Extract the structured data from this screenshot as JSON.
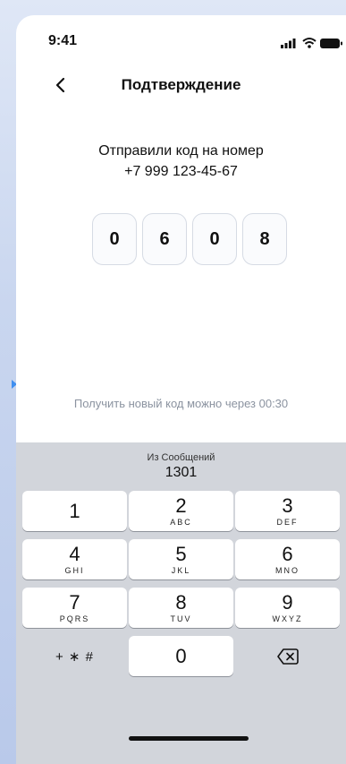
{
  "status_bar": {
    "time": "9:41",
    "icons": [
      "signal-icon",
      "wifi-icon",
      "battery-icon"
    ]
  },
  "header": {
    "title": "Подтверждение",
    "back_icon": "chevron-left-icon"
  },
  "content": {
    "sent_label": "Отправили код на номер",
    "phone_number": "+7 999 123-45-67",
    "code_digits": [
      "0",
      "6",
      "0",
      "8"
    ],
    "resend_text": "Получить новый код можно через 00:30"
  },
  "keyboard": {
    "suggestion_label": "Из Сообщений",
    "suggestion_code": "1301",
    "keys": [
      {
        "num": "1",
        "letters": ""
      },
      {
        "num": "2",
        "letters": "ABC"
      },
      {
        "num": "3",
        "letters": "DEF"
      },
      {
        "num": "4",
        "letters": "GHI"
      },
      {
        "num": "5",
        "letters": "JKL"
      },
      {
        "num": "6",
        "letters": "MNO"
      },
      {
        "num": "7",
        "letters": "PQRS"
      },
      {
        "num": "8",
        "letters": "TUV"
      },
      {
        "num": "9",
        "letters": "WXYZ"
      }
    ],
    "symbols_label": "+ ∗ #",
    "zero_label": "0",
    "delete_icon": "backspace-icon"
  },
  "colors": {
    "accent": "#3f8ff0",
    "keyboard_bg": "#d2d5db",
    "muted_text": "#8b93a0"
  }
}
